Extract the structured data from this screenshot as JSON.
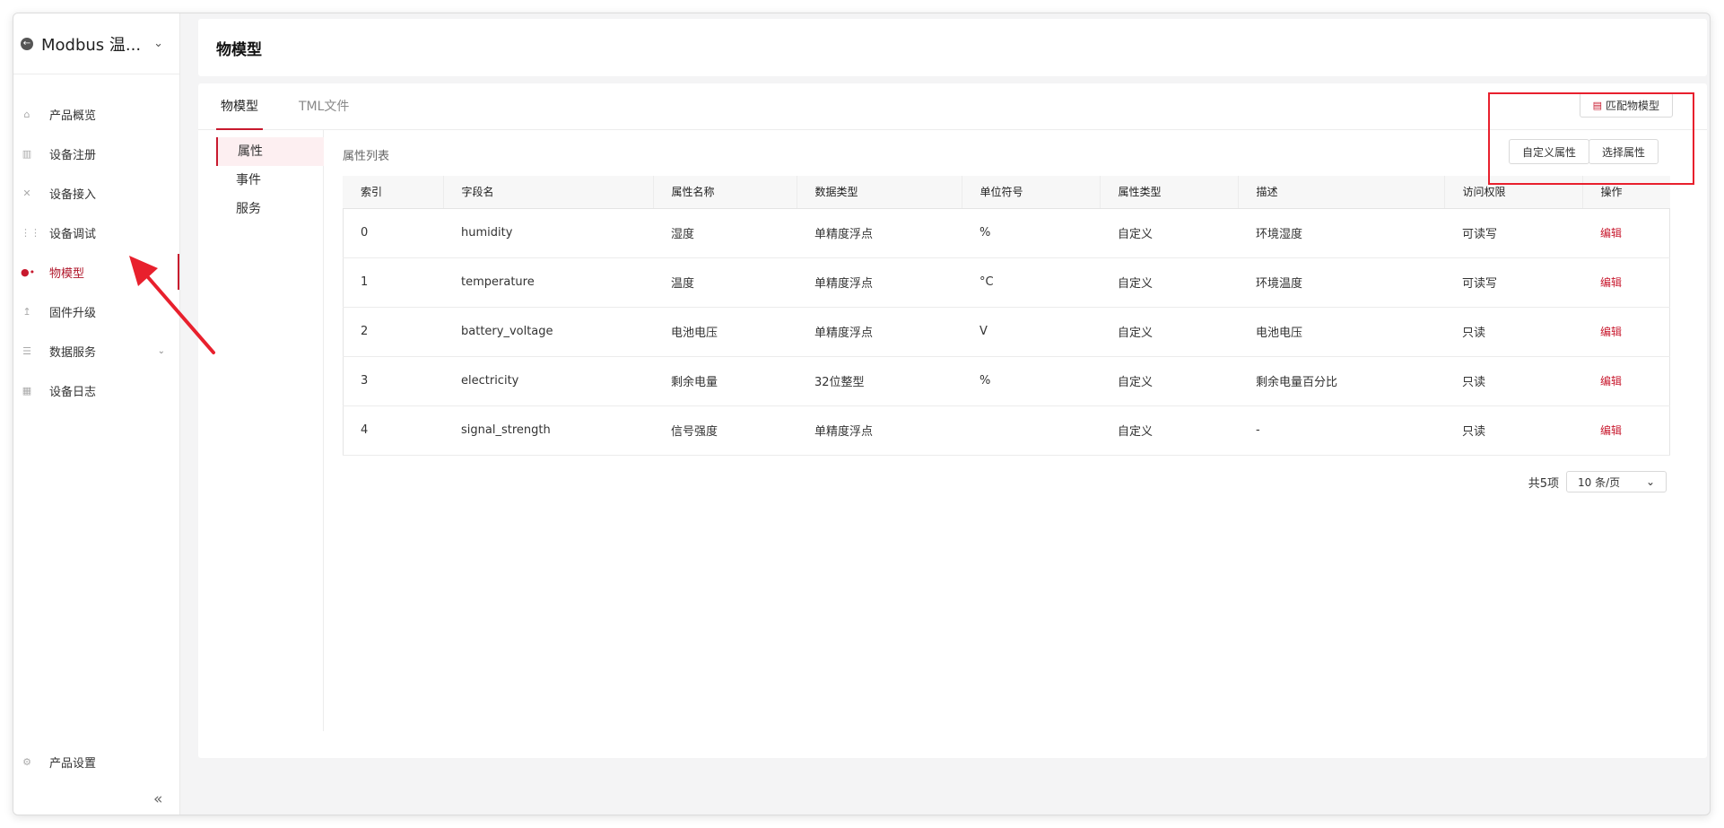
{
  "sidebar": {
    "back_icon": "back-arrow-circle-icon",
    "title": "Modbus 温...",
    "items": [
      {
        "label": "产品概览",
        "icon": "home-icon"
      },
      {
        "label": "设备注册",
        "icon": "device-register-icon"
      },
      {
        "label": "设备接入",
        "icon": "connect-icon"
      },
      {
        "label": "设备调试",
        "icon": "sliders-icon"
      },
      {
        "label": "物模型",
        "icon": "model-nodes-icon",
        "active": true
      },
      {
        "label": "固件升级",
        "icon": "upload-icon"
      },
      {
        "label": "数据服务",
        "icon": "database-icon",
        "has_children": true
      },
      {
        "label": "设备日志",
        "icon": "log-icon"
      }
    ],
    "settings_label": "产品设置",
    "collapse_icon": "double-chevron-left-icon"
  },
  "header": {
    "title": "物模型"
  },
  "tabs": [
    {
      "label": "物模型",
      "active": true
    },
    {
      "label": "TML文件",
      "active": false
    }
  ],
  "match_button": "匹配物模型",
  "subnav": [
    {
      "label": "属性",
      "active": true
    },
    {
      "label": "事件"
    },
    {
      "label": "服务"
    }
  ],
  "list": {
    "title": "属性列表",
    "custom_button": "自定义属性",
    "select_button": "选择属性",
    "columns": [
      "索引",
      "字段名",
      "属性名称",
      "数据类型",
      "单位符号",
      "属性类型",
      "描述",
      "访问权限",
      "操作"
    ],
    "rows": [
      [
        "0",
        "humidity",
        "湿度",
        "单精度浮点",
        "%",
        "自定义",
        "环境湿度",
        "可读写",
        "编辑"
      ],
      [
        "1",
        "temperature",
        "温度",
        "单精度浮点",
        "°C",
        "自定义",
        "环境温度",
        "可读写",
        "编辑"
      ],
      [
        "2",
        "battery_voltage",
        "电池电压",
        "单精度浮点",
        "V",
        "自定义",
        "电池电压",
        "只读",
        "编辑"
      ],
      [
        "3",
        "electricity",
        "剩余电量",
        "32位整型",
        "%",
        "自定义",
        "剩余电量百分比",
        "只读",
        "编辑"
      ],
      [
        "4",
        "signal_strength",
        "信号强度",
        "单精度浮点",
        "",
        "自定义",
        "-",
        "只读",
        "编辑"
      ]
    ]
  },
  "pager": {
    "total": "共5项",
    "page_size": "10 条/页"
  },
  "colors": {
    "accent": "#c8192e",
    "annotation": "#e8202d"
  }
}
